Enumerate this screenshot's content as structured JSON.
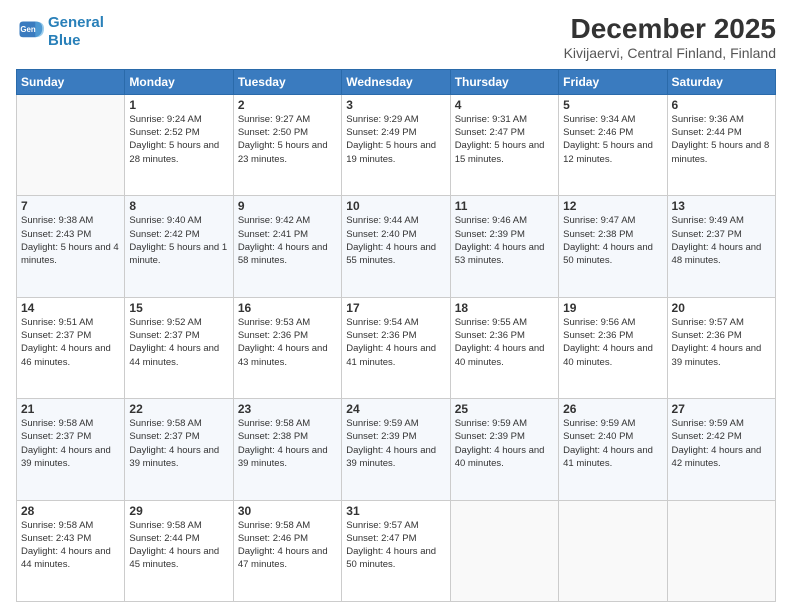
{
  "logo": {
    "line1": "General",
    "line2": "Blue"
  },
  "header": {
    "month_title": "December 2025",
    "location": "Kivijaervi, Central Finland, Finland"
  },
  "weekdays": [
    "Sunday",
    "Monday",
    "Tuesday",
    "Wednesday",
    "Thursday",
    "Friday",
    "Saturday"
  ],
  "weeks": [
    [
      {
        "day": "",
        "sunrise": "",
        "sunset": "",
        "daylight": ""
      },
      {
        "day": "1",
        "sunrise": "Sunrise: 9:24 AM",
        "sunset": "Sunset: 2:52 PM",
        "daylight": "Daylight: 5 hours and 28 minutes."
      },
      {
        "day": "2",
        "sunrise": "Sunrise: 9:27 AM",
        "sunset": "Sunset: 2:50 PM",
        "daylight": "Daylight: 5 hours and 23 minutes."
      },
      {
        "day": "3",
        "sunrise": "Sunrise: 9:29 AM",
        "sunset": "Sunset: 2:49 PM",
        "daylight": "Daylight: 5 hours and 19 minutes."
      },
      {
        "day": "4",
        "sunrise": "Sunrise: 9:31 AM",
        "sunset": "Sunset: 2:47 PM",
        "daylight": "Daylight: 5 hours and 15 minutes."
      },
      {
        "day": "5",
        "sunrise": "Sunrise: 9:34 AM",
        "sunset": "Sunset: 2:46 PM",
        "daylight": "Daylight: 5 hours and 12 minutes."
      },
      {
        "day": "6",
        "sunrise": "Sunrise: 9:36 AM",
        "sunset": "Sunset: 2:44 PM",
        "daylight": "Daylight: 5 hours and 8 minutes."
      }
    ],
    [
      {
        "day": "7",
        "sunrise": "Sunrise: 9:38 AM",
        "sunset": "Sunset: 2:43 PM",
        "daylight": "Daylight: 5 hours and 4 minutes."
      },
      {
        "day": "8",
        "sunrise": "Sunrise: 9:40 AM",
        "sunset": "Sunset: 2:42 PM",
        "daylight": "Daylight: 5 hours and 1 minute."
      },
      {
        "day": "9",
        "sunrise": "Sunrise: 9:42 AM",
        "sunset": "Sunset: 2:41 PM",
        "daylight": "Daylight: 4 hours and 58 minutes."
      },
      {
        "day": "10",
        "sunrise": "Sunrise: 9:44 AM",
        "sunset": "Sunset: 2:40 PM",
        "daylight": "Daylight: 4 hours and 55 minutes."
      },
      {
        "day": "11",
        "sunrise": "Sunrise: 9:46 AM",
        "sunset": "Sunset: 2:39 PM",
        "daylight": "Daylight: 4 hours and 53 minutes."
      },
      {
        "day": "12",
        "sunrise": "Sunrise: 9:47 AM",
        "sunset": "Sunset: 2:38 PM",
        "daylight": "Daylight: 4 hours and 50 minutes."
      },
      {
        "day": "13",
        "sunrise": "Sunrise: 9:49 AM",
        "sunset": "Sunset: 2:37 PM",
        "daylight": "Daylight: 4 hours and 48 minutes."
      }
    ],
    [
      {
        "day": "14",
        "sunrise": "Sunrise: 9:51 AM",
        "sunset": "Sunset: 2:37 PM",
        "daylight": "Daylight: 4 hours and 46 minutes."
      },
      {
        "day": "15",
        "sunrise": "Sunrise: 9:52 AM",
        "sunset": "Sunset: 2:37 PM",
        "daylight": "Daylight: 4 hours and 44 minutes."
      },
      {
        "day": "16",
        "sunrise": "Sunrise: 9:53 AM",
        "sunset": "Sunset: 2:36 PM",
        "daylight": "Daylight: 4 hours and 43 minutes."
      },
      {
        "day": "17",
        "sunrise": "Sunrise: 9:54 AM",
        "sunset": "Sunset: 2:36 PM",
        "daylight": "Daylight: 4 hours and 41 minutes."
      },
      {
        "day": "18",
        "sunrise": "Sunrise: 9:55 AM",
        "sunset": "Sunset: 2:36 PM",
        "daylight": "Daylight: 4 hours and 40 minutes."
      },
      {
        "day": "19",
        "sunrise": "Sunrise: 9:56 AM",
        "sunset": "Sunset: 2:36 PM",
        "daylight": "Daylight: 4 hours and 40 minutes."
      },
      {
        "day": "20",
        "sunrise": "Sunrise: 9:57 AM",
        "sunset": "Sunset: 2:36 PM",
        "daylight": "Daylight: 4 hours and 39 minutes."
      }
    ],
    [
      {
        "day": "21",
        "sunrise": "Sunrise: 9:58 AM",
        "sunset": "Sunset: 2:37 PM",
        "daylight": "Daylight: 4 hours and 39 minutes."
      },
      {
        "day": "22",
        "sunrise": "Sunrise: 9:58 AM",
        "sunset": "Sunset: 2:37 PM",
        "daylight": "Daylight: 4 hours and 39 minutes."
      },
      {
        "day": "23",
        "sunrise": "Sunrise: 9:58 AM",
        "sunset": "Sunset: 2:38 PM",
        "daylight": "Daylight: 4 hours and 39 minutes."
      },
      {
        "day": "24",
        "sunrise": "Sunrise: 9:59 AM",
        "sunset": "Sunset: 2:39 PM",
        "daylight": "Daylight: 4 hours and 39 minutes."
      },
      {
        "day": "25",
        "sunrise": "Sunrise: 9:59 AM",
        "sunset": "Sunset: 2:39 PM",
        "daylight": "Daylight: 4 hours and 40 minutes."
      },
      {
        "day": "26",
        "sunrise": "Sunrise: 9:59 AM",
        "sunset": "Sunset: 2:40 PM",
        "daylight": "Daylight: 4 hours and 41 minutes."
      },
      {
        "day": "27",
        "sunrise": "Sunrise: 9:59 AM",
        "sunset": "Sunset: 2:42 PM",
        "daylight": "Daylight: 4 hours and 42 minutes."
      }
    ],
    [
      {
        "day": "28",
        "sunrise": "Sunrise: 9:58 AM",
        "sunset": "Sunset: 2:43 PM",
        "daylight": "Daylight: 4 hours and 44 minutes."
      },
      {
        "day": "29",
        "sunrise": "Sunrise: 9:58 AM",
        "sunset": "Sunset: 2:44 PM",
        "daylight": "Daylight: 4 hours and 45 minutes."
      },
      {
        "day": "30",
        "sunrise": "Sunrise: 9:58 AM",
        "sunset": "Sunset: 2:46 PM",
        "daylight": "Daylight: 4 hours and 47 minutes."
      },
      {
        "day": "31",
        "sunrise": "Sunrise: 9:57 AM",
        "sunset": "Sunset: 2:47 PM",
        "daylight": "Daylight: 4 hours and 50 minutes."
      },
      {
        "day": "",
        "sunrise": "",
        "sunset": "",
        "daylight": ""
      },
      {
        "day": "",
        "sunrise": "",
        "sunset": "",
        "daylight": ""
      },
      {
        "day": "",
        "sunrise": "",
        "sunset": "",
        "daylight": ""
      }
    ]
  ]
}
